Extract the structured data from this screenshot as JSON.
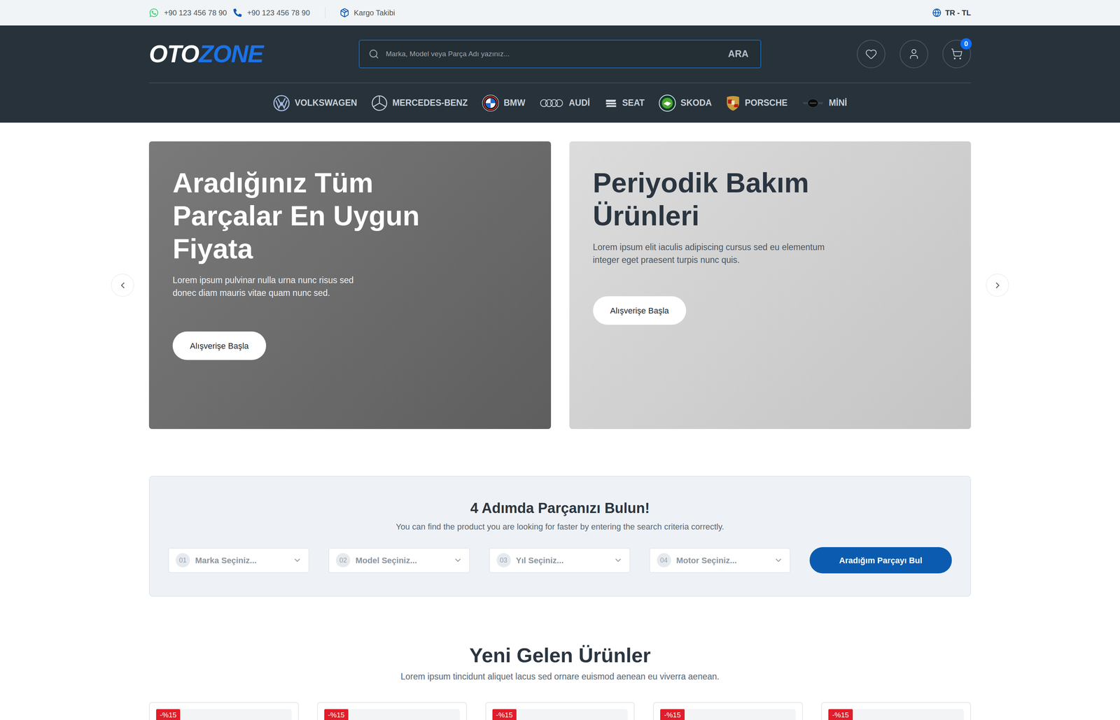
{
  "topbar": {
    "contacts": [
      {
        "kind": "whatsapp",
        "text": "+90 123 456 78 90"
      },
      {
        "kind": "phone",
        "text": "+90 123 456 78 90"
      }
    ],
    "tracking": "Kargo Takibi",
    "locale": "TR - TL"
  },
  "header": {
    "logo": {
      "first": "OTO",
      "second": "ZONE"
    },
    "search": {
      "placeholder": "Marka, Model veya Parça Adı yazınız...",
      "button": "ARA"
    },
    "cart_count": "0"
  },
  "brands": [
    {
      "name": "VOLKSWAGEN",
      "kind": "vw"
    },
    {
      "name": "MERCEDES-BENZ",
      "kind": "mercedes"
    },
    {
      "name": "BMW",
      "kind": "bmw"
    },
    {
      "name": "AUDİ",
      "kind": "audi"
    },
    {
      "name": "SEAT",
      "kind": "seat"
    },
    {
      "name": "SKODA",
      "kind": "skoda"
    },
    {
      "name": "PORSCHE",
      "kind": "porsche"
    },
    {
      "name": "MİNİ",
      "kind": "mini"
    }
  ],
  "hero": {
    "slides": [
      {
        "title": "Aradığınız Tüm Parçalar En Uygun Fiyata",
        "text": "Lorem ipsum pulvinar nulla urna nunc risus sed donec diam mauris vitae quam nunc sed.",
        "button": "Alışverişe Başla",
        "kind": "dark"
      },
      {
        "title": "Periyodik Bakım Ürünleri",
        "text": "Lorem ipsum elit iaculis adipiscing cursus sed eu elementum integer eget praesent turpis nunc quis.",
        "button": "Alışverişe Başla",
        "kind": "light"
      }
    ]
  },
  "finder": {
    "title": "4 Adımda Parçanızı Bulun!",
    "subtitle": "You can find the product you are looking for faster by entering the search criteria correctly.",
    "steps": [
      {
        "number": "01",
        "placeholder": "Marka Seçiniz..."
      },
      {
        "number": "02",
        "placeholder": "Model Seçiniz..."
      },
      {
        "number": "03",
        "placeholder": "Yıl Seçiniz..."
      },
      {
        "number": "04",
        "placeholder": "Motor Seçiniz..."
      }
    ],
    "button": "Aradığım Parçayı Bul"
  },
  "products": {
    "title": "Yeni Gelen Ürünler",
    "subtitle": "Lorem ipsum tincidunt aliquet lacus sed ornare euismod aenean eu viverra aenean.",
    "items": [
      {
        "badge": "-%15"
      },
      {
        "badge": "-%15"
      },
      {
        "badge": "-%15"
      },
      {
        "badge": "-%15"
      },
      {
        "badge": "-%15"
      }
    ]
  }
}
